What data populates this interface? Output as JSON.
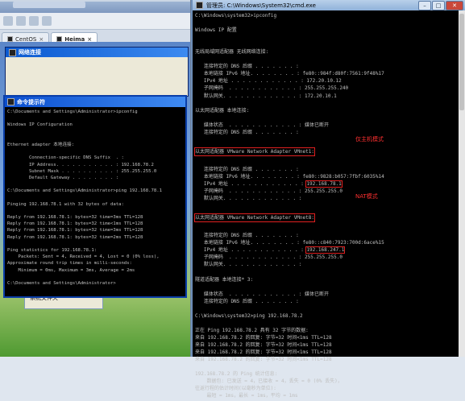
{
  "vmware": {
    "tabs": [
      {
        "label": "CentOS",
        "active": false
      },
      {
        "label": "Heima",
        "active": true
      }
    ],
    "guest": {
      "network_window_title": "网络连接",
      "folder_label": "系统文件夹"
    }
  },
  "xp_cmd": {
    "title": "命令提示符",
    "lines": [
      "C:\\Documents and Settings\\Administrator>ipconfig",
      "",
      "Windows IP Configuration",
      "",
      "",
      "Ethernet adapter 本地连接:",
      "",
      "        Connection-specific DNS Suffix  . :",
      "        IP Address. . . . . . . . . . . : 192.168.78.2",
      "        Subnet Mask . . . . . . . . . . : 255.255.255.0",
      "        Default Gateway . . . . . . . . :",
      "",
      "C:\\Documents and Settings\\Administrator>ping 192.168.78.1",
      "",
      "Pinging 192.168.78.1 with 32 bytes of data:",
      "",
      "Reply from 192.168.78.1: bytes=32 time=3ms TTL=128",
      "Reply from 192.168.78.1: bytes=32 time<1ms TTL=128",
      "Reply from 192.168.78.1: bytes=32 time=3ms TTL=128",
      "Reply from 192.168.78.1: bytes=32 time=2ms TTL=128",
      "",
      "Ping statistics for 192.168.78.1:",
      "    Packets: Sent = 4, Received = 4, Lost = 0 (0% loss),",
      "Approximate round trip times in milli-seconds:",
      "    Minimum = 0ms, Maximum = 3ms, Average = 2ms",
      "",
      "C:\\Documents and Settings\\Administrator>"
    ]
  },
  "w7_cmd": {
    "title": "管理员: C:\\Windows\\System32\\cmd.exe",
    "controls": {
      "minimize": "–",
      "maximize": "□",
      "close": "✕"
    },
    "lines": [
      "C:\\Windows\\system32>ipconfig",
      "",
      "Windows IP 配置",
      "",
      "",
      "无线局域网适配器 无线网络连接:",
      "",
      "   连接特定的 DNS 后缀 . . . . . . . :",
      "   本地链接 IPv6 地址. . . . . . . . : fe80::984f:d80f:7561:9f48%17",
      "   IPv4 地址 . . . . . . . . . . . . : 172.20.10.12",
      "   子网掩码  . . . . . . . . . . . . : 255.255.255.240",
      "   默认网关. . . . . . . . . . . . . : 172.20.10.1",
      "",
      "以太网适配器 本地连接:",
      "",
      "   媒体状态  . . . . . . . . . . . . : 媒体已断开",
      "   连接特定的 DNS 后缀 . . . . . . . :",
      "",
      "以太网适配器 VMware Network Adapter VMnet1:",
      "",
      "   连接特定的 DNS 后缀 . . . . . . . :",
      "   本地链接 IPv6 地址. . . . . . . . : fe80::9828:b057:7fbf:6035%14",
      "   IPv4 地址 . . . . . . . . . . . . : 192.168.78.1",
      "   子网掩码  . . . . . . . . . . . . : 255.255.255.0",
      "   默认网关. . . . . . . . . . . . . :",
      "",
      "以太网适配器 VMware Network Adapter VMnet8:",
      "",
      "   连接特定的 DNS 后缀 . . . . . . . :",
      "   本地链接 IPv6 地址. . . . . . . . : fe80::c840:7923:700d:6ace%15",
      "   IPv4 地址 . . . . . . . . . . . . : 192.168.247.1",
      "   子网掩码  . . . . . . . . . . . . : 255.255.255.0",
      "   默认网关. . . . . . . . . . . . . :",
      "",
      "隧道适配器 本地连接* 3:",
      "",
      "   媒体状态  . . . . . . . . . . . . : 媒体已断开",
      "   连接特定的 DNS 后缀 . . . . . . . :",
      "",
      "C:\\Windows\\system32>ping 192.168.78.2",
      "",
      "正在 Ping 192.168.78.2 具有 32 字节的数据:",
      "来自 192.168.78.2 的回复: 字节=32 时间<1ms TTL=128",
      "来自 192.168.78.2 的回复: 字节=32 时间<1ms TTL=128",
      "来自 192.168.78.2 的回复: 字节=32 时间<1ms TTL=128",
      "来自 192.168.78.2 的回复: 字节=32 时间<1ms TTL=128",
      "",
      "192.168.78.2 的 Ping 统计信息:",
      "    数据包: 已发送 = 4，已接收 = 4，丢失 = 0 (0% 丢失)，",
      "往返行程的估计时间(以毫秒为单位):",
      "    最短 = 1ms，最长 = 1ms，平均 = 1ms"
    ],
    "annotations": {
      "host_only": "仅主机模式",
      "nat": "NAT模式"
    },
    "highlight_color": "#e02020"
  }
}
